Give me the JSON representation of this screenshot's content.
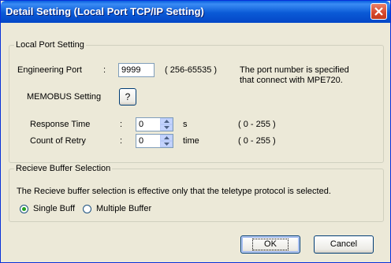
{
  "window": {
    "title": "Detail Setting (Local Port TCP/IP Setting)"
  },
  "local_port": {
    "legend": "Local Port Setting",
    "engineering_port_label": "Engineering Port",
    "colon": ":",
    "engineering_port_value": "9999",
    "engineering_port_range": "( 256-65535 )",
    "note_line1": "The port number is specified",
    "note_line2": "that connect with MPE720.",
    "memobus_label": "MEMOBUS Setting",
    "memobus_button": "?",
    "response_time_label": "Response Time",
    "response_time_value": "0",
    "response_time_unit": "s",
    "response_time_range": "( 0 - 255 )",
    "retry_label": "Count of Retry",
    "retry_value": "0",
    "retry_unit": "time",
    "retry_range": "( 0 - 255 )"
  },
  "buffer": {
    "legend": "Recieve Buffer Selection",
    "description": "The Recieve buffer selection is effective only that the teletype protocol is selected.",
    "options": [
      {
        "label": "Single Buff",
        "selected": true
      },
      {
        "label": "Multiple Buffer",
        "selected": false
      }
    ]
  },
  "buttons": {
    "ok": "OK",
    "cancel": "Cancel"
  },
  "colors": {
    "titlebar": "#0a5ad6",
    "close": "#d6482b",
    "dialog_bg": "#ece9d8",
    "radio_selected": "#21a121"
  }
}
